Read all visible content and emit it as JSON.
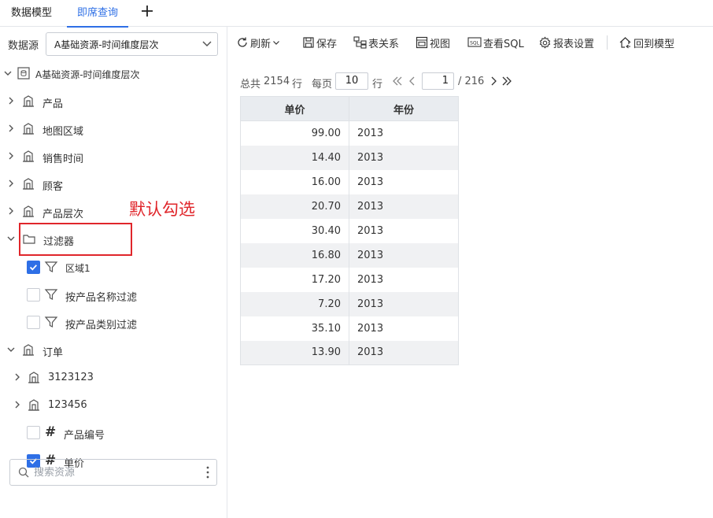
{
  "tabs": [
    {
      "label": "数据模型",
      "active": false
    },
    {
      "label": "即席查询",
      "active": true
    }
  ],
  "datasource": {
    "label": "数据源",
    "selected": "A基础资源-时间维度层次"
  },
  "tree": {
    "root": "A基础资源-时间维度层次",
    "items": [
      {
        "label": "产品"
      },
      {
        "label": "地图区域"
      },
      {
        "label": "销售时间"
      },
      {
        "label": "顾客"
      },
      {
        "label": "产品层次"
      },
      {
        "label": "过滤器"
      },
      {
        "label": "区域1",
        "checked": true
      },
      {
        "label": "按产品名称过滤",
        "checked": false
      },
      {
        "label": "按产品类别过滤",
        "checked": false
      },
      {
        "label": "订单"
      },
      {
        "label": "3123123"
      },
      {
        "label": "123456"
      },
      {
        "label": "产品编号",
        "checked": false
      },
      {
        "label": "单价",
        "checked": true
      }
    ]
  },
  "annotation": "默认勾选",
  "search": {
    "placeholder": "搜索资源"
  },
  "toolbar": {
    "refresh": "刷新",
    "save": "保存",
    "relations": "表关系",
    "view": "视图",
    "sql": "查看SQL",
    "report_settings": "报表设置",
    "back_to_model": "回到模型"
  },
  "pager": {
    "total_prefix": "总共",
    "total": "2154",
    "total_suffix": "行",
    "per_page_label": "每页",
    "per_page": "10",
    "per_page_suffix": "行",
    "current_page": "1",
    "page_count": "/ 216"
  },
  "table": {
    "headers": [
      "单价",
      "年份"
    ],
    "rows": [
      [
        "99.00",
        "2013"
      ],
      [
        "14.40",
        "2013"
      ],
      [
        "16.00",
        "2013"
      ],
      [
        "20.70",
        "2013"
      ],
      [
        "30.40",
        "2013"
      ],
      [
        "16.80",
        "2013"
      ],
      [
        "17.20",
        "2013"
      ],
      [
        "7.20",
        "2013"
      ],
      [
        "35.10",
        "2013"
      ],
      [
        "13.90",
        "2013"
      ]
    ]
  },
  "colors": {
    "accent": "#2e6fe6",
    "annotation": "#e0262b"
  }
}
